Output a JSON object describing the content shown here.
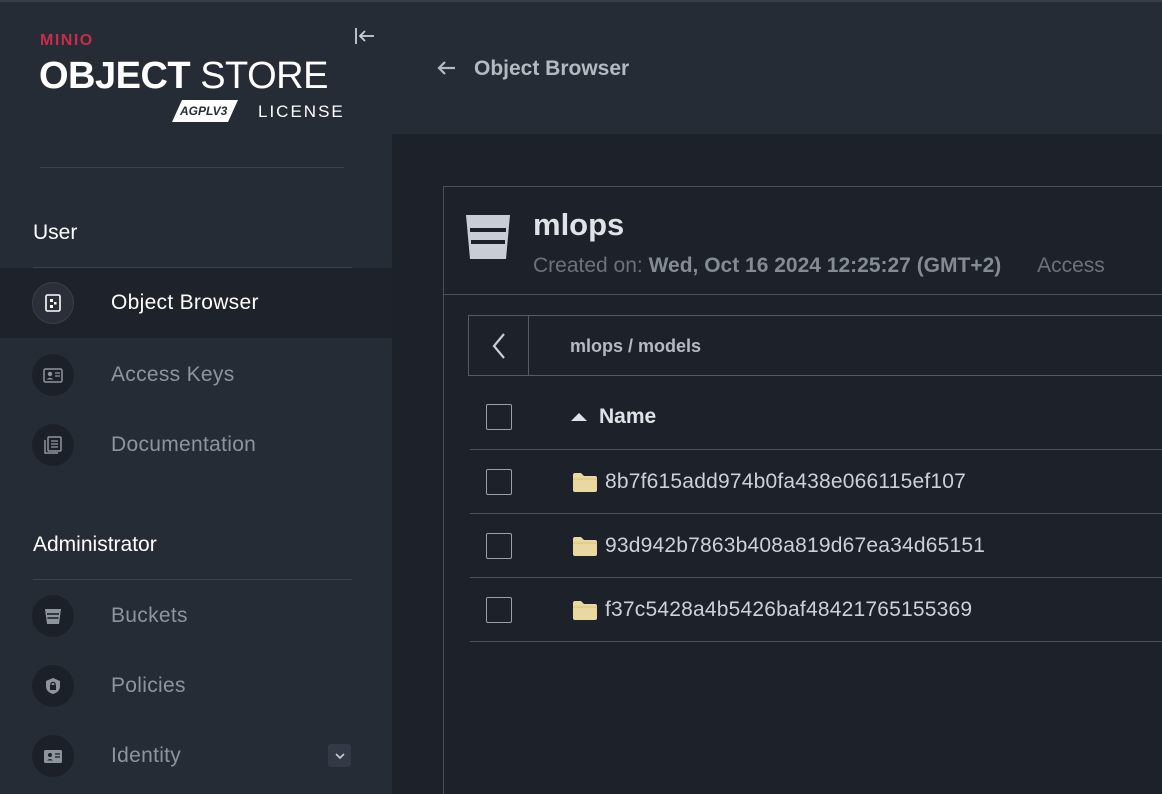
{
  "logo": {
    "brand": "MINIO",
    "product_bold": "OBJECT",
    "product_light": " STORE",
    "agpl": "AGPLV3",
    "license": "LICENSE"
  },
  "sidebar": {
    "user_section": "User",
    "admin_section": "Administrator",
    "user_items": [
      {
        "label": "Object Browser",
        "icon": "object-browser-icon",
        "active": true
      },
      {
        "label": "Access Keys",
        "icon": "access-keys-icon"
      },
      {
        "label": "Documentation",
        "icon": "documentation-icon"
      }
    ],
    "admin_items": [
      {
        "label": "Buckets",
        "icon": "bucket-icon"
      },
      {
        "label": "Policies",
        "icon": "policies-icon"
      },
      {
        "label": "Identity",
        "icon": "identity-icon",
        "expandable": true
      }
    ]
  },
  "header": {
    "title": "Object Browser"
  },
  "bucket": {
    "name": "mlops",
    "created_label": "Created on:",
    "created_value": "Wed, Oct 16 2024 12:25:27 (GMT+2)",
    "access_label": "Access"
  },
  "breadcrumb": {
    "bucket": "mlops",
    "separator": "/",
    "folder": "models"
  },
  "table": {
    "column_name": "Name",
    "sort": "ascending",
    "rows": [
      {
        "name": "8b7f615add974b0fa438e066115ef107",
        "type": "folder"
      },
      {
        "name": "93d942b7863b408a819d67ea34d65151",
        "type": "folder"
      },
      {
        "name": "f37c5428a4b5426baf48421765155369",
        "type": "folder"
      }
    ]
  },
  "colors": {
    "accent_red": "#c72c48",
    "sidebar_bg": "#262c36",
    "main_bg": "#1d2129",
    "folder": "#e9d9a0"
  }
}
